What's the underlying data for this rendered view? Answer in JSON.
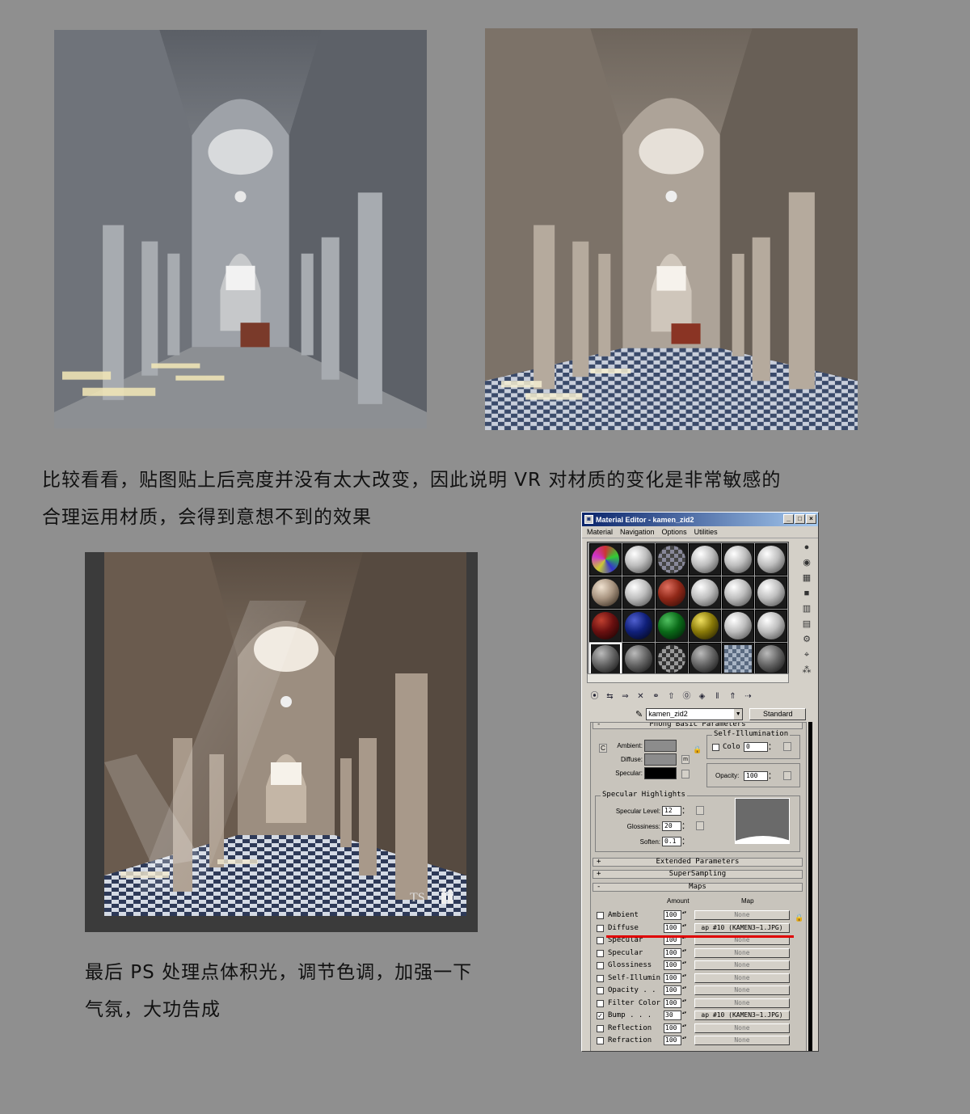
{
  "captions": {
    "line1": "比较看看，贴图贴上后亮度并没有太大改变，因此说明 VR 对材质的变化是非常敏感的",
    "line2": "合理运用材质，会得到意想不到的效果",
    "line3": "最后 PS 处理点体积光，调节色调，加强一下",
    "line4": "气氛，大功告成"
  },
  "renders": {
    "untextured": "cathedral-interior-untextured-render",
    "textured": "cathedral-interior-textured-render",
    "final": "cathedral-interior-final-ps-render"
  },
  "watermark": "TS",
  "material_editor": {
    "title": "Material Editor - kamen_zid2",
    "menu": [
      "Material",
      "Navigation",
      "Options",
      "Utilities"
    ],
    "window_buttons": [
      "_",
      "□",
      "×"
    ],
    "slots": [
      [
        "multicolor",
        "white",
        "checker-color",
        "white",
        "white",
        "white"
      ],
      [
        "tan",
        "white",
        "red",
        "white",
        "white",
        "white"
      ],
      [
        "darkred",
        "navy",
        "green",
        "yellow",
        "white",
        "white"
      ],
      [
        "gray",
        "gray",
        "checker-gray",
        "gray",
        "checker-flat",
        "gray"
      ]
    ],
    "material_name": "kamen_zid2",
    "material_type": "Standard",
    "rollouts": {
      "phong_basic": "Phong Basic Parameters",
      "extended": "Extended Parameters",
      "supersampling": "SuperSampling",
      "maps": "Maps"
    },
    "basic": {
      "ambient_label": "Ambient:",
      "diffuse_label": "Diffuse:",
      "specular_label": "Specular:",
      "ambient_color": "#8c8c8c",
      "diffuse_color": "#8c8c8c",
      "specular_color": "#000000",
      "m_button": "m",
      "self_illum_title": "Self-Illumination",
      "color_label": "Colo",
      "color_value": "0",
      "opacity_label": "Opacity:",
      "opacity_value": "100"
    },
    "specular_highlights": {
      "title": "Specular Highlights",
      "level_label": "Specular Level:",
      "level_value": "12",
      "gloss_label": "Glossiness:",
      "gloss_value": "20",
      "soften_label": "Soften:",
      "soften_value": "0.1"
    },
    "maps_header": {
      "amount": "Amount",
      "map": "Map"
    },
    "maps": [
      {
        "name": "Ambient",
        "checked": false,
        "amount": "100",
        "map": "None"
      },
      {
        "name": "Diffuse",
        "checked": false,
        "amount": "100",
        "map": "ap #10 (KAMEN3~1.JPG)"
      },
      {
        "name": "Specular",
        "checked": false,
        "amount": "100",
        "map": "None"
      },
      {
        "name": "Specular",
        "checked": false,
        "amount": "100",
        "map": "None"
      },
      {
        "name": "Glossiness",
        "checked": false,
        "amount": "100",
        "map": "None"
      },
      {
        "name": "Self-Illumin",
        "checked": false,
        "amount": "100",
        "map": "None"
      },
      {
        "name": "Opacity . .",
        "checked": false,
        "amount": "100",
        "map": "None"
      },
      {
        "name": "Filter Color",
        "checked": false,
        "amount": "100",
        "map": "None"
      },
      {
        "name": "Bump . . .",
        "checked": true,
        "amount": "30",
        "map": "ap #10 (KAMEN3~1.JPG)"
      },
      {
        "name": "Reflection",
        "checked": false,
        "amount": "100",
        "map": "None"
      },
      {
        "name": "Refraction",
        "checked": false,
        "amount": "100",
        "map": "None"
      }
    ],
    "highlight_color": "#e00000"
  }
}
